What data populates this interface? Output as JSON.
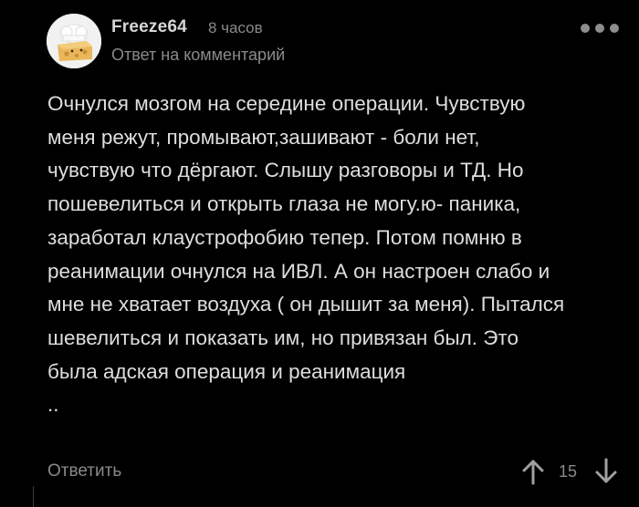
{
  "comment": {
    "author": "Freeze64",
    "time": "8 часов",
    "reply_label": "Ответ на комментарий",
    "avatar_icon": "cheese-chef-avatar-icon",
    "menu_icon": "more-dots-icon",
    "body_lines": [
      "Очнулся мозгом на середине операции. Чувствую",
      "меня режут, промывают,зашивают - боли нет,",
      "чувствую что дёргают. Слышу разговоры и ТД. Но",
      "пошевелиться и открыть глаза не могу.ю- паника,",
      "заработал клаустрофобию тепер. Потом помню в",
      "реанимации очнулся на ИВЛ. А он настроен слабо и",
      "мне не хватает воздуха ( он дышит за меня). Пытался",
      "шевелиться и показать им, но привязан был. Это",
      "была адская операция и реанимация",
      ".."
    ]
  },
  "actions": {
    "reply_button_label": "Ответить",
    "vote_up_icon": "arrow-up-icon",
    "vote_down_icon": "arrow-down-icon",
    "rating": "15"
  },
  "colors": {
    "background": "#000000",
    "text": "#dedede",
    "muted": "#8a8a8a"
  }
}
